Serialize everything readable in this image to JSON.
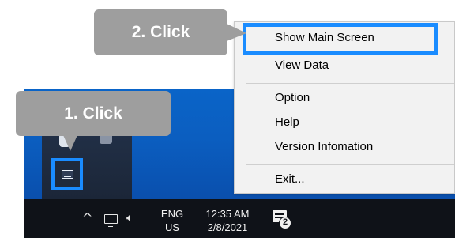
{
  "callouts": {
    "step1": "1. Click",
    "step2": "2. Click"
  },
  "context_menu": {
    "items": [
      {
        "label": "Show Main Screen",
        "highlighted": true
      },
      {
        "label": "View Data"
      },
      {
        "label": "Option"
      },
      {
        "label": "Help"
      },
      {
        "label": "Version Infomation"
      },
      {
        "label": "Exit..."
      }
    ]
  },
  "taskbar": {
    "tray_overflow_icon": "chevron-up-icon",
    "network_icon": "network-icon",
    "volume_icon": "volume-icon",
    "language_line1": "ENG",
    "language_line2": "US",
    "time": "12:35 AM",
    "date": "2/8/2021",
    "notification_count": "2"
  },
  "colors": {
    "highlight": "#1a8cff",
    "callout_bg": "#9e9e9e",
    "taskbar_bg": "#0f1218",
    "desktop_bg": "#0a64c8",
    "menu_bg": "#f2f2f2"
  }
}
